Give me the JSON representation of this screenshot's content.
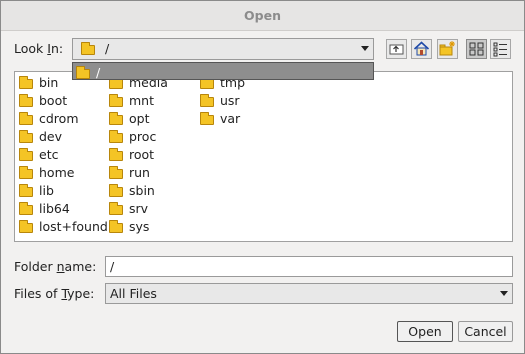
{
  "dialog": {
    "title": "Open"
  },
  "look_in": {
    "label_pre": "Look ",
    "label_mnemonic": "I",
    "label_post": "n:",
    "value": "/"
  },
  "toolbar": {
    "up_icon": "up-folder-icon",
    "home_icon": "home-icon",
    "new_folder_icon": "new-folder-icon",
    "list_icon": "list-view-icon",
    "details_icon": "details-view-icon"
  },
  "dropdown": {
    "item": "/"
  },
  "files": {
    "col1": [
      "bin",
      "boot",
      "cdrom",
      "dev",
      "etc",
      "home",
      "lib",
      "lib64",
      "lost+found"
    ],
    "col2": [
      "media",
      "mnt",
      "opt",
      "proc",
      "root",
      "run",
      "sbin",
      "srv",
      "sys"
    ],
    "col3": [
      "tmp",
      "usr",
      "var"
    ]
  },
  "folder_name": {
    "label_pre": "Folder ",
    "label_mnemonic": "n",
    "label_post": "ame:",
    "value": "/"
  },
  "files_of_type": {
    "label_pre": "Files of ",
    "label_mnemonic": "T",
    "label_post": "ype:",
    "value": "All Files"
  },
  "buttons": {
    "open": "Open",
    "cancel": "Cancel"
  },
  "colors": {
    "folder": "#f4c425",
    "dropdown_bg": "#8e8e8e"
  }
}
